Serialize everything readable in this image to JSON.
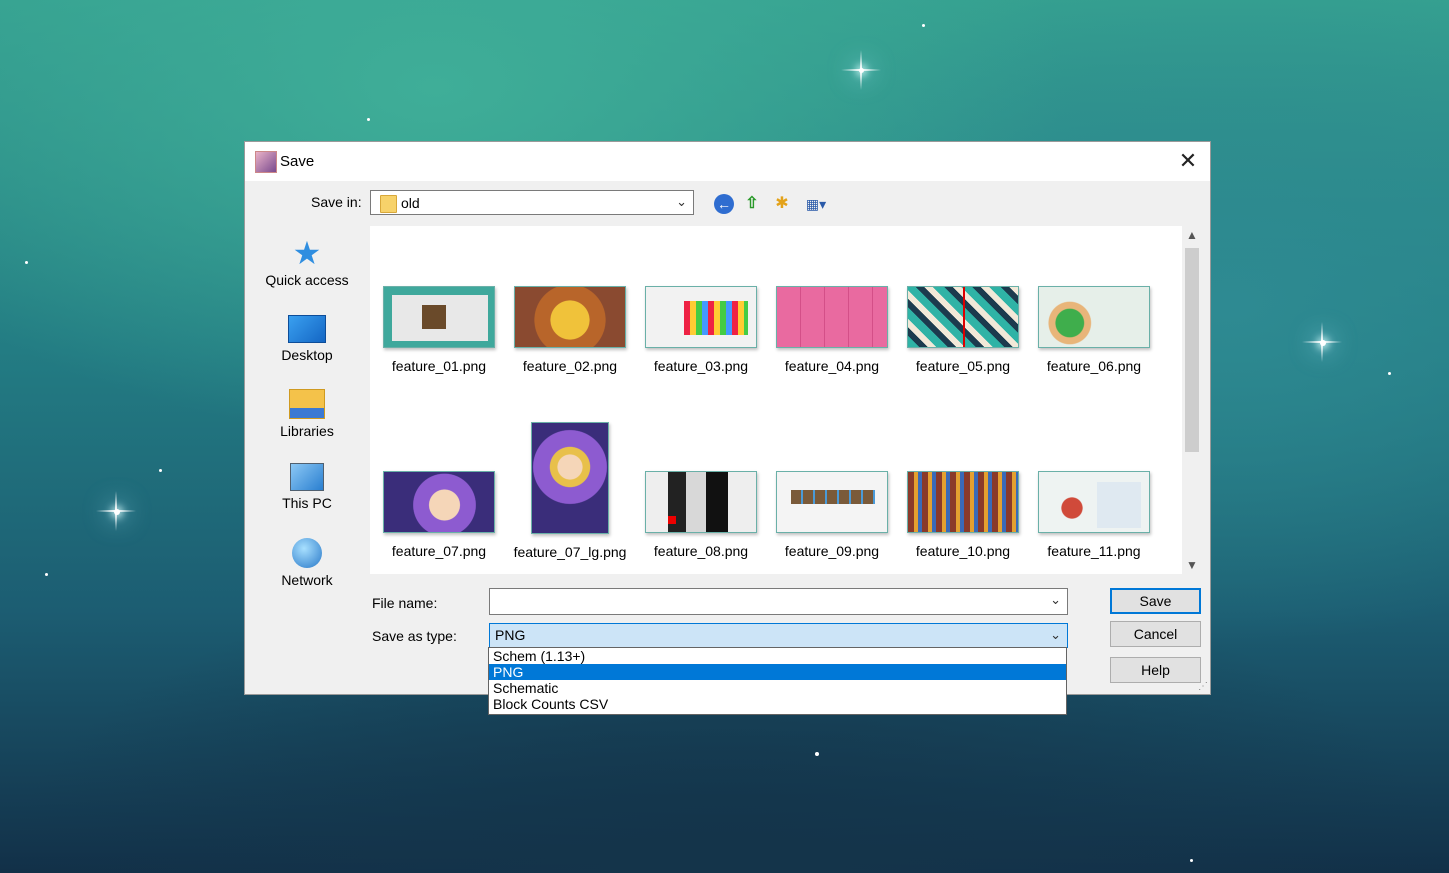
{
  "dialog": {
    "title": "Save",
    "close_glyph": "✕"
  },
  "toolbar": {
    "save_in_label": "Save in:",
    "save_in_value": "old",
    "back_icon": "←",
    "up_icon": "⇧",
    "new_folder_icon": "✱",
    "view_icon": "▦▾"
  },
  "places": [
    {
      "label": "Quick access",
      "icon": "star-icon"
    },
    {
      "label": "Desktop",
      "icon": "desktop-icon"
    },
    {
      "label": "Libraries",
      "icon": "libraries-icon"
    },
    {
      "label": "This PC",
      "icon": "computer-icon"
    },
    {
      "label": "Network",
      "icon": "network-icon"
    }
  ],
  "files": [
    {
      "name": "feature_01.png"
    },
    {
      "name": "feature_02.png"
    },
    {
      "name": "feature_03.png"
    },
    {
      "name": "feature_04.png"
    },
    {
      "name": "feature_05.png"
    },
    {
      "name": "feature_06.png"
    },
    {
      "name": "feature_07.png"
    },
    {
      "name": "feature_07_lg.png"
    },
    {
      "name": "feature_08.png"
    },
    {
      "name": "feature_09.png"
    },
    {
      "name": "feature_10.png"
    },
    {
      "name": "feature_11.png"
    }
  ],
  "form": {
    "file_name_label": "File name:",
    "file_name_value": "",
    "save_type_label": "Save as type:",
    "save_type_value": "PNG",
    "save_type_options": [
      "Schem (1.13+)",
      "PNG",
      "Schematic",
      "Block Counts CSV"
    ],
    "selected_option": "PNG"
  },
  "buttons": {
    "save": "Save",
    "cancel": "Cancel",
    "help": "Help"
  },
  "colors": {
    "accent": "#0078d7",
    "selection_bg": "#cce4f7"
  }
}
